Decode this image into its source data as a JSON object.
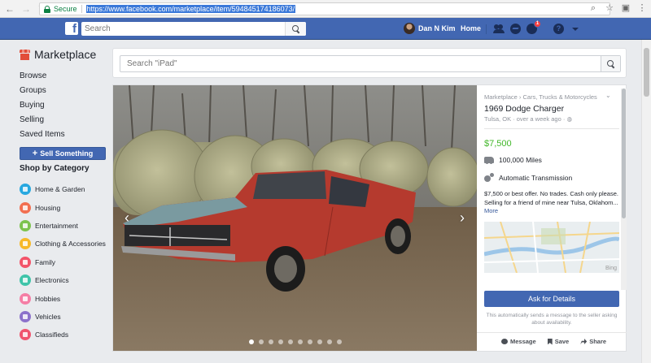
{
  "browser": {
    "secure_label": "Secure",
    "url": "https://www.facebook.com/marketplace/item/594845174186073/"
  },
  "fb": {
    "logo": "f",
    "search_placeholder": "Search",
    "user_name": "Dan N Kim",
    "home_label": "Home",
    "notification_count": "1"
  },
  "sidebar": {
    "title": "Marketplace",
    "links": [
      "Browse",
      "Groups",
      "Buying",
      "Selling",
      "Saved Items"
    ],
    "sell_label": "Sell Something",
    "category_heading": "Shop by Category",
    "categories": [
      {
        "label": "Home & Garden",
        "color": "#27a8e0"
      },
      {
        "label": "Housing",
        "color": "#f26f51"
      },
      {
        "label": "Entertainment",
        "color": "#7dc34d"
      },
      {
        "label": "Clothing & Accessories",
        "color": "#f7b928"
      },
      {
        "label": "Family",
        "color": "#f35369"
      },
      {
        "label": "Electronics",
        "color": "#3fc4a9"
      },
      {
        "label": "Hobbies",
        "color": "#f57ea5"
      },
      {
        "label": "Vehicles",
        "color": "#8c72cb"
      },
      {
        "label": "Classifieds",
        "color": "#f0556e"
      }
    ]
  },
  "main_search": {
    "placeholder": "Search \"iPad\""
  },
  "listing": {
    "breadcrumb": "Marketplace › Cars, Trucks & Motorcycles",
    "title": "1969 Dodge Charger",
    "location": "Tulsa, OK · over a week ago ·",
    "price": "$7,500",
    "mileage": "100,000 Miles",
    "transmission": "Automatic Transmission",
    "description": "$7,500 or best offer. No trades. Cash only please. Selling for a friend of mine near Tulsa, Oklahom...",
    "more_label": "More",
    "map_brand": "Bing",
    "ask_label": "Ask for Details",
    "ask_note": "This automatically sends a message to the seller asking about availability.",
    "actions": {
      "message": "Message",
      "save": "Save",
      "share": "Share"
    },
    "photo_count": 10,
    "active_photo": 0
  },
  "colors": {
    "fb_blue": "#4267b2",
    "price_green": "#42b72a",
    "car_red": "#b53a2e"
  }
}
